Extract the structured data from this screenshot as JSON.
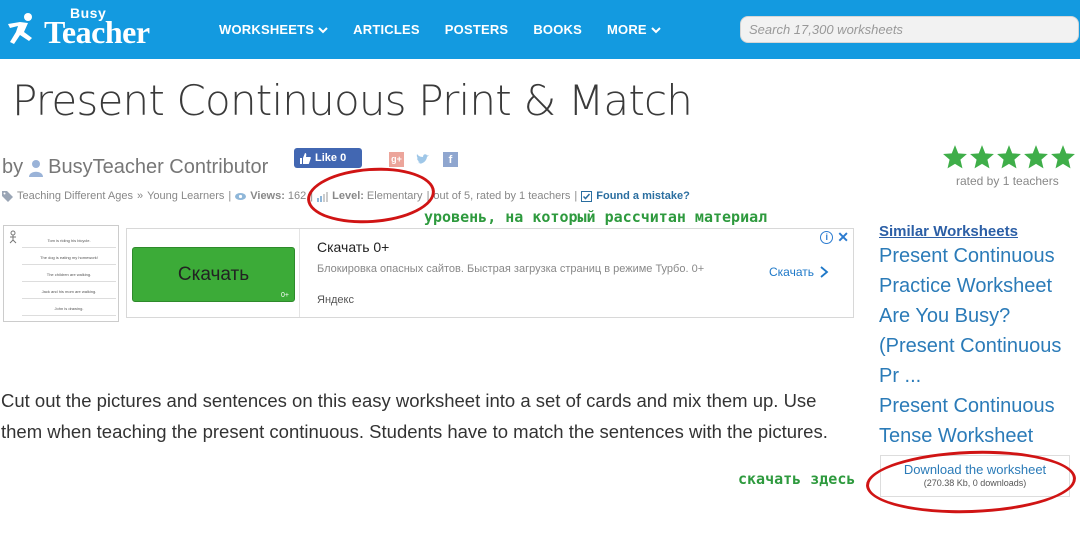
{
  "brand": {
    "small": "Busy",
    "large": "Teacher"
  },
  "nav": {
    "items": [
      {
        "label": "WORKSHEETS",
        "has_dropdown": true
      },
      {
        "label": "ARTICLES",
        "has_dropdown": false
      },
      {
        "label": "POSTERS",
        "has_dropdown": false
      },
      {
        "label": "BOOKS",
        "has_dropdown": false
      },
      {
        "label": "MORE",
        "has_dropdown": true
      }
    ],
    "search_placeholder": "Search 17,300 worksheets"
  },
  "page": {
    "title": "Present Continuous Print & Match",
    "by": "by",
    "author": "BusyTeacher Contributor",
    "like_label": "Like 0"
  },
  "rating": {
    "stars": 5,
    "rated_by": "rated by 1 teachers"
  },
  "meta": {
    "category": "Teaching Different Ages",
    "arrow": "»",
    "subcategory": "Young Learners",
    "views_label": "Views:",
    "views": "162",
    "level_label": "Level:",
    "level": "Elementary",
    "rating_text": "out of 5, rated by 1 teachers",
    "mistake": "Found a mistake?"
  },
  "annotations": {
    "level_note": "уровень, на который рассчитан материал",
    "download_note": "скачать здесь"
  },
  "thumbnail": {
    "lines": [
      "Tom is riding his bicycle.",
      "The dog is eating my homework!",
      "The children are walking.",
      "Jack and his mom are walking.",
      "John is drawing."
    ]
  },
  "ad": {
    "button": "Скачать",
    "button_badge": "0+",
    "title": "Скачать 0+",
    "description": "Блокировка опасных сайтов. Быстрая загрузка страниц в режиме Турбо. 0+",
    "brand": "Яндекс",
    "link": "Скачать"
  },
  "description": "Cut out the pictures and sentences on this easy worksheet into a set of cards and mix them up. Use them when teaching the present continuous. Students have to match the sentences with the pictures.",
  "sidebar": {
    "heading": "Similar Worksheets",
    "items": [
      "Present Continuous Practice Worksheet",
      "Are You Busy? (Present Continuous Pr ...",
      "Present Continuous Tense Worksheet"
    ]
  },
  "download": {
    "label": "Download the worksheet",
    "info": "(270.38 Kb, 0 downloads)"
  },
  "colors": {
    "nav_bg": "#139ae0",
    "star": "#3fae49",
    "link": "#2b7bb8",
    "annotation_green": "#2e9a3e",
    "annotation_red": "#d01414"
  },
  "icons": {
    "logo": "runner-icon",
    "author": "user-icon",
    "category": "tag-icon",
    "views": "eye-icon",
    "level": "signal-bars-icon",
    "mistake": "check-square-icon",
    "ad_arrow": "chevron-right-icon"
  }
}
